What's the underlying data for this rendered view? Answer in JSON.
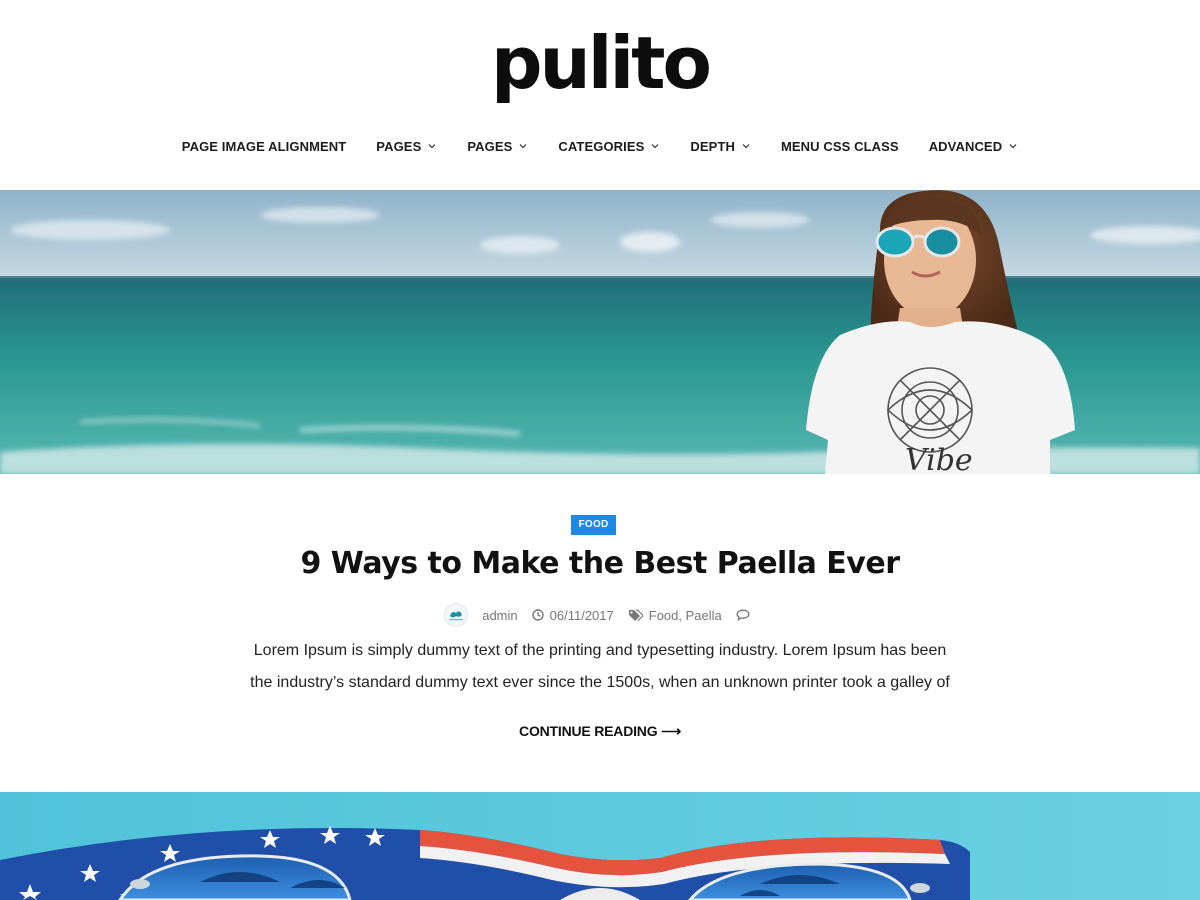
{
  "site": {
    "logo_text": "pulito"
  },
  "nav": {
    "items": [
      {
        "label": "PAGE IMAGE ALIGNMENT",
        "has_dropdown": false
      },
      {
        "label": "PAGES",
        "has_dropdown": true
      },
      {
        "label": "PAGES",
        "has_dropdown": true
      },
      {
        "label": "CATEGORIES",
        "has_dropdown": true
      },
      {
        "label": "DEPTH",
        "has_dropdown": true
      },
      {
        "label": "MENU CSS CLASS",
        "has_dropdown": false
      },
      {
        "label": "ADVANCED",
        "has_dropdown": true
      }
    ]
  },
  "post": {
    "category": "FOOD",
    "title": "9 Ways to Make the Best Paella Ever",
    "author": "admin",
    "date": "06/11/2017",
    "tags": [
      "Food",
      "Paella"
    ],
    "excerpt_line1": "Lorem Ipsum is simply dummy text of the printing and typesetting industry. Lorem Ipsum has been",
    "excerpt_line2": "the industry’s standard dummy text ever since the 1500s, when an unknown printer took a galley of",
    "read_more": "CONTINUE READING ⟶"
  },
  "colors": {
    "accent": "#1e88e5",
    "text": "#111111",
    "meta": "#777777"
  },
  "icons": {
    "chevron": "chevron-down-icon",
    "clock": "clock-icon",
    "tags": "tags-icon",
    "comments": "comments-icon"
  }
}
